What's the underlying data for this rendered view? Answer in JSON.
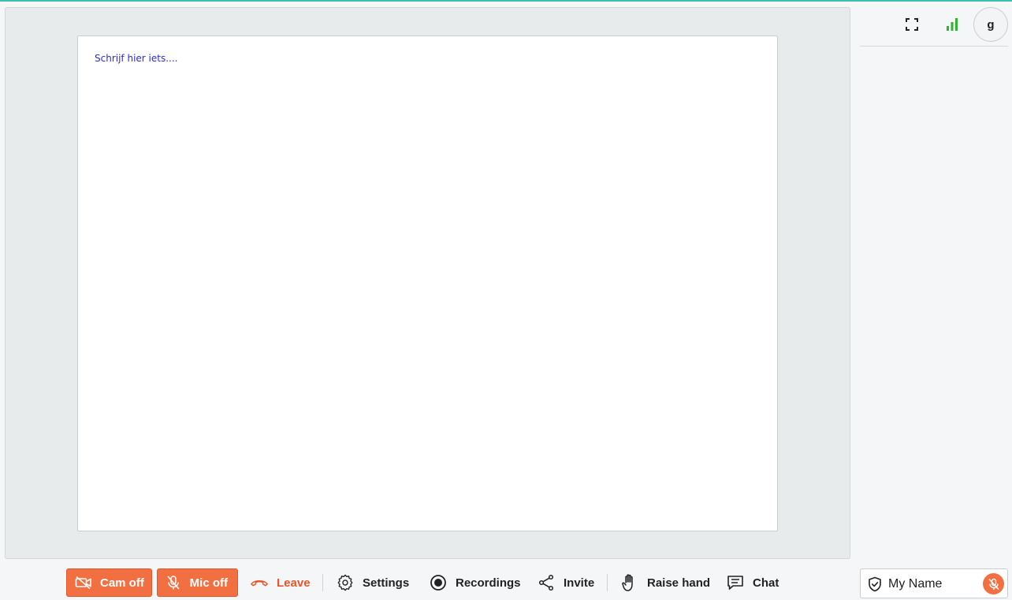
{
  "colors": {
    "accent_top": "#3ebfb0",
    "danger_orange": "#f26f42",
    "leave_text": "#e8552a",
    "placeholder_blue": "#2b2bd8",
    "signal_green": "#2fb52f"
  },
  "whiteboard": {
    "placeholder": "Schrijf hier iets...."
  },
  "header": {
    "fullscreen_icon": "fullscreen-icon",
    "signal_icon": "signal-strength-icon",
    "avatar_initial": "g"
  },
  "toolbar": {
    "cam": {
      "label": "Cam off",
      "icon": "camera-off-icon"
    },
    "mic": {
      "label": "Mic off",
      "icon": "microphone-off-icon"
    },
    "leave": {
      "label": "Leave",
      "icon": "phone-hangup-icon"
    },
    "settings": {
      "label": "Settings",
      "icon": "gear-icon"
    },
    "recordings": {
      "label": "Recordings",
      "icon": "record-icon"
    },
    "invite": {
      "label": "Invite",
      "icon": "share-icon"
    },
    "raise_hand": {
      "label": "Raise hand",
      "icon": "hand-icon"
    },
    "chat": {
      "label": "Chat",
      "icon": "chat-icon"
    }
  },
  "self_tile": {
    "name": "My Name",
    "shield_icon": "shield-icon",
    "mic_icon": "microphone-off-icon"
  }
}
